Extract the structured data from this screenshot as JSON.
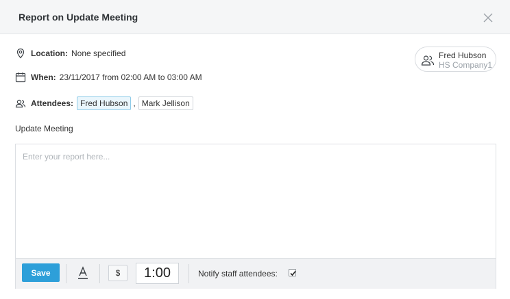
{
  "modal": {
    "title": "Report on Update Meeting"
  },
  "details": {
    "location_label": "Location:",
    "location_value": "None specified",
    "when_label": "When:",
    "when_value": "23/11/2017 from 02:00 AM to 03:00 AM",
    "attendees_label": "Attendees:",
    "attendees": [
      "Fred Hubson",
      "Mark Jellison"
    ],
    "attendee_separator": ","
  },
  "customer": {
    "name": "Fred Hubson",
    "company": "HS Company1"
  },
  "report": {
    "section_label": "Update Meeting",
    "placeholder": "Enter your report here...",
    "value": ""
  },
  "toolbar": {
    "save_label": "Save",
    "currency_symbol": "$",
    "duration": "1:00",
    "notify_label": "Notify staff attendees:",
    "notify_checked": true
  },
  "colors": {
    "accent": "#2d9fd9",
    "header_bg": "#f5f6f7",
    "toolbar_bg": "#f1f2f4"
  },
  "icons": [
    "close-icon",
    "location-pin-icon",
    "calendar-icon",
    "users-icon",
    "text-format-icon",
    "checkmark-icon"
  ]
}
